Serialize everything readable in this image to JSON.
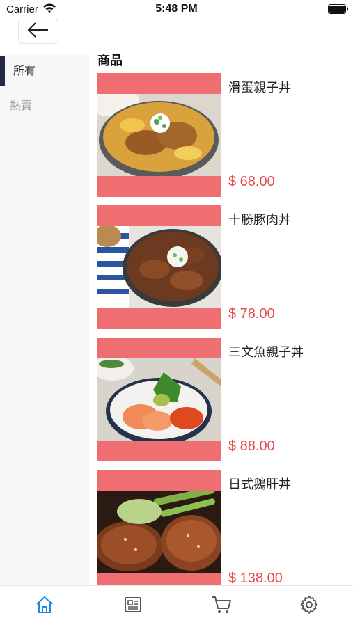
{
  "status": {
    "carrier": "Carrier",
    "time": "5:48 PM"
  },
  "sidebar": {
    "items": [
      {
        "label": "所有",
        "active": true
      },
      {
        "label": "熱賣",
        "active": false
      }
    ]
  },
  "section_title": "商品",
  "products": [
    {
      "name": "滑蛋親子丼",
      "price": "$ 68.00"
    },
    {
      "name": "十勝豚肉丼",
      "price": "$ 78.00"
    },
    {
      "name": "三文魚親子丼",
      "price": "$ 88.00"
    },
    {
      "name": "日式鵝肝丼",
      "price": "$ 138.00"
    }
  ],
  "tabbar": {
    "items": [
      {
        "icon": "home-icon",
        "active": true
      },
      {
        "icon": "newspaper-icon",
        "active": false
      },
      {
        "icon": "cart-icon",
        "active": false
      },
      {
        "icon": "gear-icon",
        "active": false
      }
    ]
  },
  "colors": {
    "accent_blue": "#1e88e5",
    "price_red": "#e64a4a",
    "image_frame": "#ee6e72",
    "sidebar_indicator": "#232b44"
  }
}
